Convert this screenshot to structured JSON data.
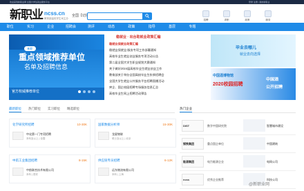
{
  "topbar": {
    "left": "欢迎来到新职业网 全国大学生就业服务平台",
    "right": "登录 注册 | 我的新职业"
  },
  "header": {
    "logo_text": "新职业",
    "domain": "ncss.cn",
    "domain_sub": "教育部高校学生司主办",
    "city": "全国【切换】",
    "links": [
      "招聘",
      "求职",
      "政策",
      "服务"
    ]
  },
  "nav": {
    "items": [
      "职位",
      "实习",
      "企业",
      "招聘会",
      "测评",
      "动态",
      "政策",
      "指导",
      "基层",
      "专题"
    ]
  },
  "banner": {
    "pill": "新职",
    "title": "重点领域推荐单位",
    "subtitle": "名单及招聘信息",
    "caption": "官方权威推荐单位",
    "active_dot": 0
  },
  "news": {
    "head": "稳就业 · 出台助就业政策汇编",
    "items": [
      {
        "text": "稳就业保就业政策汇编",
        "highlight": true
      },
      {
        "text": "稳就业保就业:服务专项工作部署通知",
        "highlight": false
      },
      {
        "text": "高校毕业生就业创业服务专项活动公告",
        "highlight": false
      },
      {
        "text": "第二届全国大学生职业规划大赛通知",
        "highlight": false
      },
      {
        "text": "关于做好2024届高校毕业生就业创业工作",
        "highlight": false
      },
      {
        "text": "教育部关于举办全国高校毕业生秋季招聘会",
        "highlight": false
      },
      {
        "text": "全国大学生就业公共服务平台招聘直播活动",
        "highlight": false
      },
      {
        "text": "央企、国企校园招聘专场服务信息汇总",
        "highlight": false
      },
      {
        "text": "高校毕业生网上招聘活动预告",
        "highlight": false
      }
    ]
  },
  "right_panel": {
    "a_line1": "毕业去哪儿",
    "a_line2": "就业去向选择",
    "b_line1": "中国酒博物馆",
    "b_line2": "2020校园招聘",
    "b_line3": "公开招聘",
    "b_line4": "中国酒"
  },
  "tabs": {
    "items": [
      "最新职位",
      "热门职位",
      "实习职位",
      "精选职位"
    ],
    "active": 0
  },
  "rtabs": {
    "label": "热门企业"
  },
  "cards": [
    {
      "title": "化学研究所招聘",
      "salary": "10-30K",
      "company": "中化第一门专项招聘",
      "detail": "本科及以上 | 全国"
    },
    {
      "title": "国家数据分析师",
      "salary": "15-30K",
      "company": "龙星物联",
      "detail": "硕士及以上 | 北京"
    },
    {
      "title": "中航工业集团招聘",
      "salary": "8-15K",
      "company": "中航联合技术有限公司",
      "detail": "本科 | 西安"
    },
    {
      "title": "供应链专员招聘",
      "salary": "6-12K",
      "company": "远东物流有限公司",
      "detail": "本科 | 上海"
    }
  ],
  "companies": [
    {
      "left_name": "DIST",
      "mid": "数字中国研究院",
      "right_name": "智慧城市建设"
    },
    {
      "left_name": "钢铁集团",
      "mid": "重点国企单位",
      "right_name": "中国建筑"
    },
    {
      "left_name": "能源集团",
      "mid": "电力能源企业",
      "right_name": "电网公司"
    },
    {
      "left_name": "ncss",
      "mid": "优秀企业推荐",
      "right_name": "科技公司"
    }
  ],
  "watermark": "@新职业网",
  "colors": {
    "primary": "#1e8be8",
    "accent": "#d6322b",
    "salary": "#f07b1c"
  }
}
